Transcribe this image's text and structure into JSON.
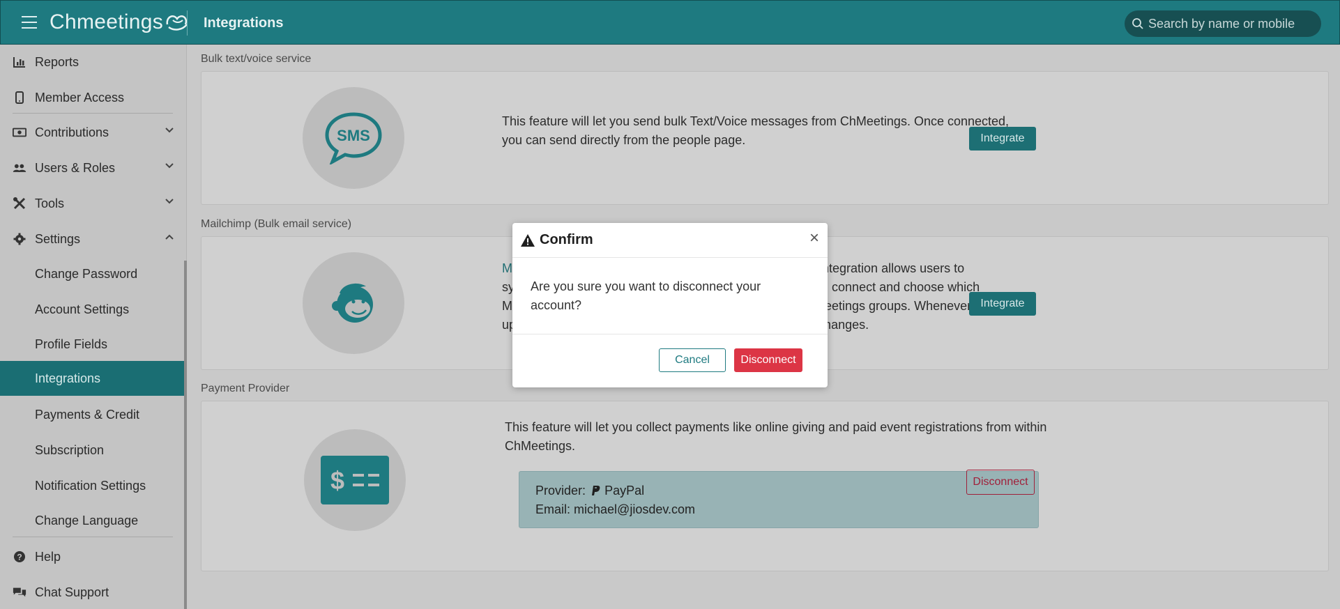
{
  "header": {
    "logo_text": "Chmeetings",
    "title": "Integrations",
    "search_placeholder": "Search by name or mobile"
  },
  "sidebar": {
    "items": [
      {
        "label": "Reports",
        "icon": "chart-icon"
      },
      {
        "label": "Member Access",
        "icon": "mobile-icon"
      },
      {
        "label": "Contributions",
        "icon": "money-icon"
      },
      {
        "label": "Users & Roles",
        "icon": "users-icon"
      },
      {
        "label": "Tools",
        "icon": "tools-icon"
      },
      {
        "label": "Settings",
        "icon": "gear-icon"
      },
      {
        "label": "Change Password"
      },
      {
        "label": "Account Settings"
      },
      {
        "label": "Profile Fields"
      },
      {
        "label": "Integrations"
      },
      {
        "label": "Payments & Credit"
      },
      {
        "label": "Subscription"
      },
      {
        "label": "Notification Settings"
      },
      {
        "label": "Change Language"
      },
      {
        "label": "Help",
        "icon": "question-icon"
      },
      {
        "label": "Chat Support",
        "icon": "chat-icon"
      }
    ]
  },
  "sections": {
    "sms": {
      "label": "Bulk text/voice service",
      "icon_text": "SMS",
      "desc": "This feature will let you send bulk Text/Voice messages from ChMeetings. Once connected, you can send directly from the people page.",
      "button": "Integrate"
    },
    "mailchimp": {
      "label": "Mailchimp (Bulk email service)",
      "line1_link": "M",
      "line1": "mp integration allows users to",
      "line2_pre": "sy",
      "line2": "u can connect and choose which",
      "line3_pre": "M",
      "line3": "ChMeetings groups. Whenever you",
      "line4_pre": "up",
      "line4": "he changes.",
      "button": "Integrate"
    },
    "payment": {
      "label": "Payment Provider",
      "desc": "This feature will let you collect payments like online giving and paid event registrations from within ChMeetings.",
      "provider_label": "Provider:",
      "provider_name": "PayPal",
      "email_label": "Email:",
      "email": "michael@jiosdev.com",
      "button": "Disconnect"
    }
  },
  "modal": {
    "title": "Confirm",
    "close": "×",
    "message": "Are you sure you want to disconnect your account?",
    "cancel": "Cancel",
    "confirm": "Disconnect"
  },
  "colors": {
    "brand": "#1e7a80",
    "danger": "#dc3545"
  }
}
